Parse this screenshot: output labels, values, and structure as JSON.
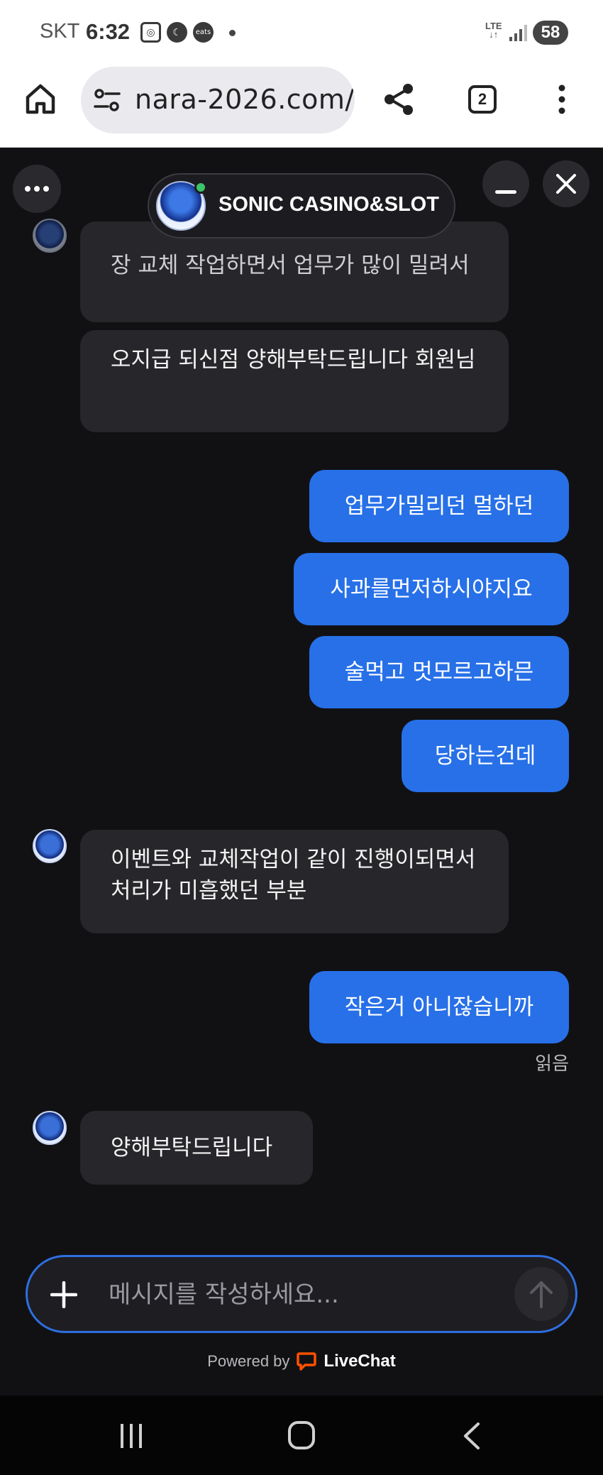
{
  "status_bar": {
    "carrier": "SKT",
    "time": "6:32",
    "network": "LTE",
    "battery": "58",
    "notification_icons": [
      "screenshot-icon",
      "moon-icon",
      "coupang-eats-icon"
    ],
    "eats_label": "eats"
  },
  "browser": {
    "url": "nara-2026.com/",
    "tab_count": "2"
  },
  "chat_header": {
    "title": "SONIC CASINO&SLOT"
  },
  "messages": [
    {
      "sender": "agent",
      "text": "장 교체 작업하면서 업무가 많이 밀려서"
    },
    {
      "sender": "agent",
      "text": "오지급 되신점 양해부탁드립니다 회원님"
    },
    {
      "sender": "user",
      "text": "업무가밀리던 멀하던"
    },
    {
      "sender": "user",
      "text": "사과를먼저하시야지요"
    },
    {
      "sender": "user",
      "text": "술먹고 멋모르고하믄"
    },
    {
      "sender": "user",
      "text": "당하는건데"
    },
    {
      "sender": "agent",
      "text": "이벤트와 교체작업이 같이 진행이되면서 처리가 미흡했던 부분"
    },
    {
      "sender": "user",
      "text": "작은거 아니잖습니까"
    },
    {
      "sender": "agent",
      "text": "양해부탁드립니다"
    }
  ],
  "read_status": "읽음",
  "composer": {
    "placeholder": "메시지를 작성하세요..."
  },
  "footer": {
    "powered_by": "Powered by",
    "brand": "LiveChat",
    "brand_color": "#ff5100"
  },
  "colors": {
    "user_bubble": "#2770e8",
    "agent_bubble": "#27272b",
    "background": "#111114",
    "online": "#3cc46a"
  }
}
